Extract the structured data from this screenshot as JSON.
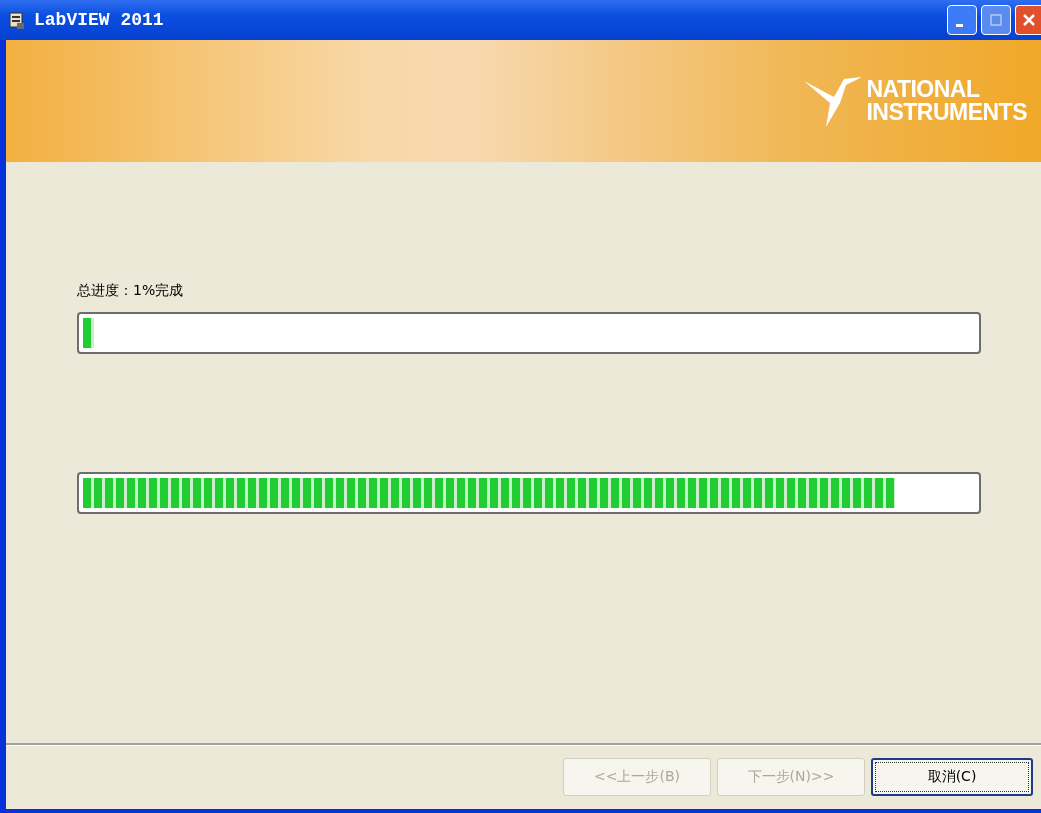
{
  "window": {
    "title": "LabVIEW 2011"
  },
  "banner": {
    "logo_lines": [
      "NATIONAL",
      "INSTRUMENTS"
    ]
  },
  "overall": {
    "label": "总进度：1%完成",
    "level": 0.01
  },
  "current": {
    "level": 0.91
  },
  "buttons": [
    {
      "label": "<<上一步(B)",
      "disabled": true,
      "focused": false
    },
    {
      "label": "下一步(N)>>",
      "disabled": true,
      "focused": false
    },
    {
      "label": "取消(C)",
      "disabled": false,
      "focused": true
    }
  ]
}
